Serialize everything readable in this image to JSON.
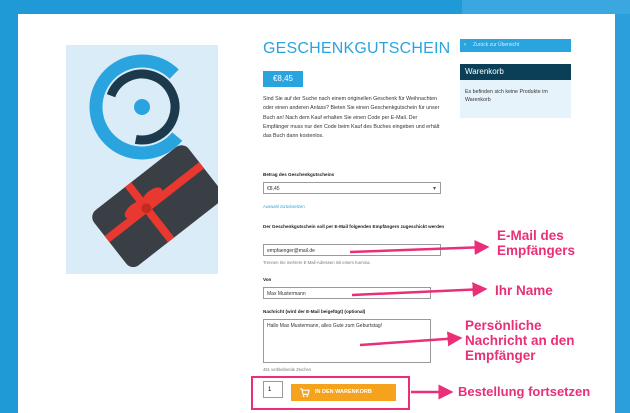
{
  "product": {
    "title": "GESCHENKGUTSCHEIN",
    "price": "€8,45",
    "description": "Sind Sie auf der Suche nach einem originellen Geschenk für Weihnachten oder einen anderen Anlass? Bieten Sie einen Geschenkgutschein für unser Buch an! Nach dem Kauf erhalten Sie einen Code per E-Mail. Der Empfänger muss nur den Code beim Kauf des Buches eingeben und erhält das Buch dann kostenlos."
  },
  "form": {
    "amount_label": "Betrag des Geschenkgutscheins",
    "amount_value": "€8,45",
    "reset_link": "Auswahl zurücksetzen",
    "email_label": "Der Geschenkgutschein soll per E-Mail folgenden Empfängern zugeschickt werden",
    "email_value": "empfaenger@mail.de",
    "email_hint": "Trennen Sie mehrere E-Mail-Adressen mit einem Komma.",
    "from_label": "Von",
    "from_value": "Max Mustermann",
    "message_label": "Nachricht (wird der E-Mail beigefügt) (optional)",
    "message_value": "Hallo Max Mustermann, alles Gute zum Geburtstag!",
    "chars_left": "451 verbleibende Zeichen",
    "quantity": "1",
    "add_to_cart": "IN DEN WARENKORB"
  },
  "sidebar": {
    "back_label": "Zurück zur Übersicht",
    "cart_title": "Warenkorb",
    "cart_empty": "Es befinden sich keine Produkte im Warenkorb"
  },
  "annotations": {
    "email": [
      "E-Mail des",
      "Empfängers"
    ],
    "name": "Ihr Name",
    "message": [
      "Persönliche",
      "Nachricht an den",
      "Empfänger"
    ],
    "order": "Bestellung fortsetzen"
  },
  "colors": {
    "accent": "#2aa4df",
    "callout": "#ea2f78",
    "button": "#f5a21d",
    "cart_header": "#0a3f57"
  }
}
